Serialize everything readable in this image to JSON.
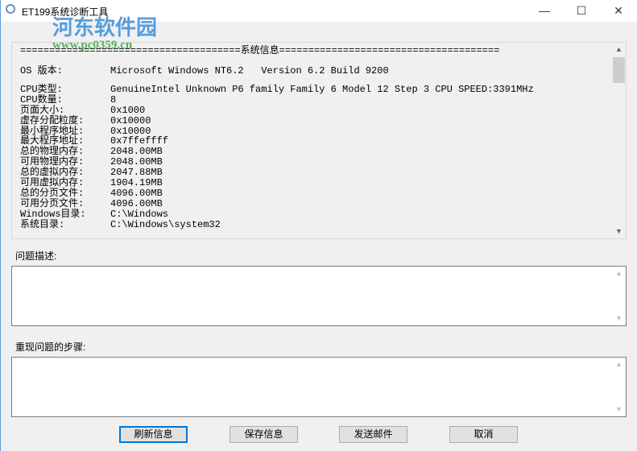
{
  "window": {
    "title": "ET199系统诊断工具",
    "minimize": "—",
    "maximize": "☐",
    "close": "✕"
  },
  "watermark": {
    "name": "河东软件园",
    "url": "www.pc0359.cn"
  },
  "info": {
    "header": "======================================系统信息======================================",
    "os": {
      "k": "OS 版本:",
      "v": "Microsoft Windows NT6.2   Version 6.2 Build 9200"
    },
    "rows": [
      {
        "k": "CPU类型:",
        "v": "GenuineIntel Unknown P6 family Family 6 Model 12 Step 3 CPU SPEED:3391MHz"
      },
      {
        "k": "CPU数量:",
        "v": "8"
      },
      {
        "k": "页面大小:",
        "v": "0x1000"
      },
      {
        "k": "虚存分配粒度:",
        "v": "0x10000"
      },
      {
        "k": "最小程序地址:",
        "v": "0x10000"
      },
      {
        "k": "最大程序地址:",
        "v": "0x7ffeffff"
      },
      {
        "k": "总的物理内存:",
        "v": "2048.00MB"
      },
      {
        "k": "可用物理内存:",
        "v": "2048.00MB"
      },
      {
        "k": "总的虚拟内存:",
        "v": "2047.88MB"
      },
      {
        "k": "可用虚拟内存:",
        "v": "1904.19MB"
      },
      {
        "k": "总的分页文件:",
        "v": "4096.00MB"
      },
      {
        "k": "可用分页文件:",
        "v": "4096.00MB"
      },
      {
        "k": "Windows目录:",
        "v": "C:\\Windows"
      },
      {
        "k": "系统目录:",
        "v": "C:\\Windows\\system32"
      }
    ]
  },
  "problem": {
    "label": "问题描述:",
    "value": ""
  },
  "steps": {
    "label": "重现问题的步骤:",
    "value": ""
  },
  "buttons": {
    "refresh": "刷新信息",
    "save": "保存信息",
    "send": "发送邮件",
    "cancel": "取消"
  }
}
